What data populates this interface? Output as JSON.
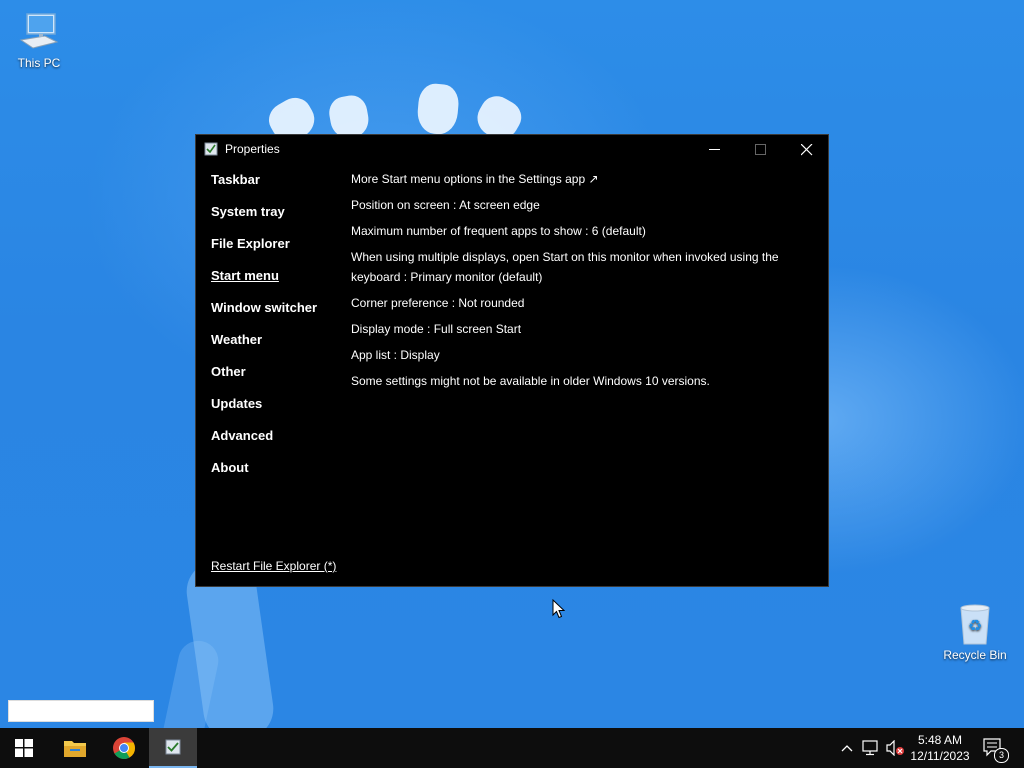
{
  "desktop": {
    "icons": [
      {
        "label": "This PC"
      },
      {
        "label": "Recycle Bin"
      }
    ]
  },
  "window": {
    "title": "Properties",
    "sidebar": {
      "items": [
        {
          "label": "Taskbar"
        },
        {
          "label": "System tray"
        },
        {
          "label": "File Explorer"
        },
        {
          "label": "Start menu",
          "active": true
        },
        {
          "label": "Window switcher"
        },
        {
          "label": "Weather"
        },
        {
          "label": "Other"
        },
        {
          "label": "Updates"
        },
        {
          "label": "Advanced"
        },
        {
          "label": "About"
        }
      ],
      "restart_link": "Restart File Explorer (*)"
    },
    "content": {
      "settings_link": "More Start menu options in the Settings app ↗",
      "position": "Position on screen : At screen edge",
      "max_frequent": "Maximum number of frequent apps to show : 6 (default)",
      "multi_display": "When using multiple displays, open Start on this monitor when invoked using the keyboard : Primary monitor (default)",
      "corner": "Corner preference : Not rounded",
      "display_mode": "Display mode : Full screen Start",
      "app_list": "App list : Display",
      "note": "Some settings might not be available in older Windows 10 versions."
    }
  },
  "taskbar": {
    "clock_time": "5:48 AM",
    "clock_date": "12/11/2023",
    "notification_count": "3"
  },
  "colors": {
    "accent": "#7ab6f0",
    "window_bg": "#000000",
    "taskbar_bg": "#0d0d0d"
  }
}
